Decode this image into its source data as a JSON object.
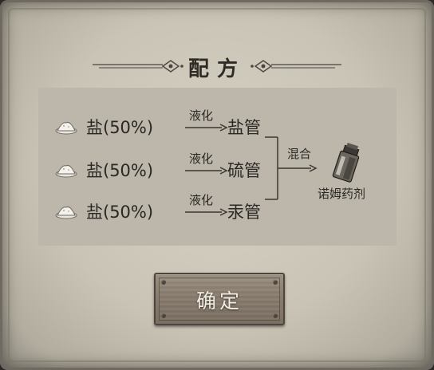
{
  "dialog": {
    "title": "配方",
    "ingredients": [
      {
        "name": "盐(50%)",
        "process": "液化",
        "result": "盐管"
      },
      {
        "name": "盐(50%)",
        "process": "液化",
        "result": "硫管"
      },
      {
        "name": "盐(50%)",
        "process": "液化",
        "result": "汞管"
      }
    ],
    "mix_label": "混合",
    "product": "诺姆药剂",
    "confirm_label": "确定"
  },
  "icons": {
    "ingredient": "salt-pile-icon",
    "product": "potion-icon",
    "arrow": "arrow-right-icon"
  },
  "colors": {
    "panel": "#bcb7aa",
    "text": "#2a2825",
    "button": "#8a7e70"
  }
}
